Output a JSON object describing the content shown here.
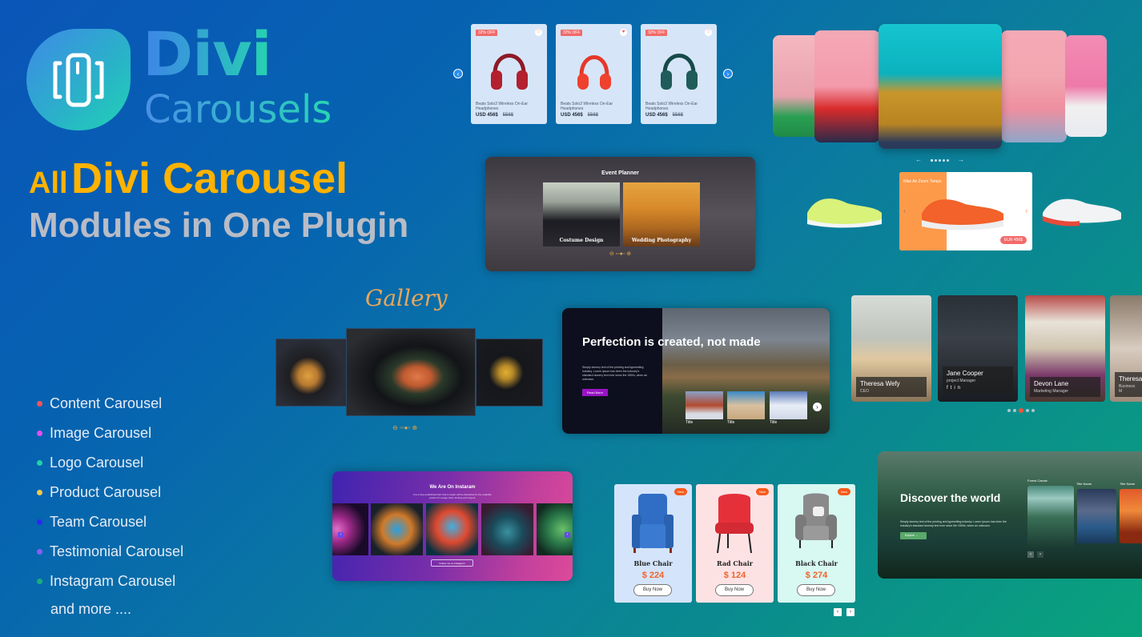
{
  "brand": {
    "logo_icon": "carousel-icon",
    "name_line1": "Divi",
    "name_line2": "Carousels"
  },
  "headline": {
    "word1": "All",
    "word2": "Divi Carousel",
    "line2": "Modules in One Plugin"
  },
  "features": [
    {
      "label": "Content Carousel",
      "color": "#f4545a"
    },
    {
      "label": "Image Carousel",
      "color": "#e64cf0"
    },
    {
      "label": "Logo Carousel",
      "color": "#22d3a4"
    },
    {
      "label": "Product Carousel",
      "color": "#f8c84a"
    },
    {
      "label": "Team Carousel",
      "color": "#2a2af0"
    },
    {
      "label": "Testimonial Carousel",
      "color": "#8a5cf6"
    },
    {
      "label": "Instagram Carousel",
      "color": "#18b07a"
    }
  ],
  "more_label": "and more ....",
  "product_carousel": {
    "prev_icon": "chevron-left-icon",
    "next_icon": "chevron-right-icon",
    "items": [
      {
        "badge": "32% OFF",
        "name": "Beats Solo3 Wireless On-Ear Headphones",
        "price": "USD 456$",
        "old_price": "556$",
        "favorited": false,
        "color": "#b3202e"
      },
      {
        "badge": "32% OFF",
        "name": "Beats Solo3 Wireless On-Ear Headphones",
        "price": "USD 456$",
        "old_price": "556$",
        "favorited": true,
        "color": "#f0402e"
      },
      {
        "badge": "32% OFF",
        "name": "Beats Solo3 Wireless On-Ear Headphones",
        "price": "USD 456$",
        "old_price": "556$",
        "favorited": false,
        "color": "#1f5c5a"
      }
    ]
  },
  "image_carousel": {
    "prev_icon": "arrow-left-icon",
    "next_icon": "arrow-right-icon",
    "dots": 5,
    "active_dot": 1
  },
  "event_carousel": {
    "title": "Event Planner",
    "items": [
      {
        "caption": "Costume Design"
      },
      {
        "caption": "Wedding Photography"
      }
    ],
    "dots": 4,
    "active_dot": 3
  },
  "sneaker_carousel": {
    "title": "Nike Air Zoom Tempo",
    "price": "EUR 456$",
    "prev_icon": "chevron-left-icon",
    "next_icon": "chevron-right-icon"
  },
  "gallery": {
    "title": "Gallery",
    "dots": 4,
    "active_dot": 3
  },
  "content_carousel": {
    "heading": "Perfection is created, not made",
    "description": "Simply dummy text of the printing and typesetting industry. Lorem Ipsum has been the industry's standard dummy text ever since the 1500s, when an unknown.",
    "button": "Read More",
    "thumbs": [
      {
        "title": "Title"
      },
      {
        "title": "Title"
      },
      {
        "title": "Title"
      }
    ],
    "next_icon": "chevron-right-icon"
  },
  "team_carousel": {
    "members": [
      {
        "name": "Theresa Wefy",
        "role": "CEO"
      },
      {
        "name": "Jane Cooper",
        "role": "project Manager",
        "social": [
          "facebook-icon",
          "twitter-icon",
          "linkedin-icon"
        ]
      },
      {
        "name": "Devon Lane",
        "role": "Marketing Manager"
      },
      {
        "name": "Theresa",
        "role": "Business M"
      }
    ],
    "dots": 5,
    "active_dot": 3
  },
  "instagram_carousel": {
    "title": "We Are On Instaram",
    "subtitle": "It is a long established fact that a reader will be distracted by the readable content of a page when looking at its layout.",
    "follow_button": "Follow me on Instagram",
    "prev_icon": "chevron-left-icon",
    "next_icon": "chevron-right-icon"
  },
  "chair_carousel": {
    "items": [
      {
        "badge": "New",
        "name": "Blue Chair",
        "price": "$ 224",
        "button": "Buy Now",
        "bg": "#d4e4fa",
        "color": "#2f6ec4"
      },
      {
        "badge": "New",
        "name": "Rad Chair",
        "price": "$ 124",
        "button": "Buy Now",
        "bg": "#fde2e4",
        "color": "#e5303a"
      },
      {
        "badge": "New",
        "name": "Black Chair",
        "price": "$ 274",
        "button": "Buy Now",
        "bg": "#d8f8f2",
        "color": "#8a8a8a"
      }
    ],
    "prev_icon": "chevron-left-icon",
    "next_icon": "chevron-right-icon"
  },
  "discover_carousel": {
    "heading": "Discover the world",
    "description": "Simply dummy text of the printing and typesetting industry. Lorem Ipsum has been the industry's standard dummy text ever since the 1500s, when an unknown.",
    "button": "Explore",
    "cards": [
      {
        "title": "Forest Cavale"
      },
      {
        "title": "Title Name"
      },
      {
        "title": "Title Name"
      }
    ],
    "prev_icon": "chevron-left-icon",
    "next_icon": "chevron-right-icon"
  }
}
